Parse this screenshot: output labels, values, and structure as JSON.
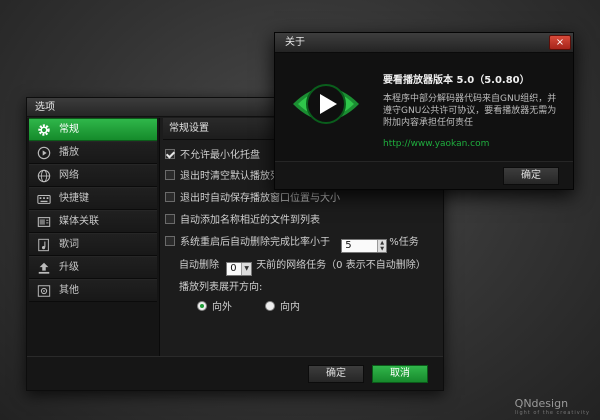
{
  "options": {
    "title": "选项",
    "sidebar": [
      {
        "label": "常规",
        "icon": "gear-icon"
      },
      {
        "label": "播放",
        "icon": "play-icon"
      },
      {
        "label": "网络",
        "icon": "globe-icon"
      },
      {
        "label": "快捷键",
        "icon": "keyboard-icon"
      },
      {
        "label": "媒体关联",
        "icon": "media-file-icon"
      },
      {
        "label": "歌词",
        "icon": "music-note-icon"
      },
      {
        "label": "升级",
        "icon": "upload-icon"
      },
      {
        "label": "其他",
        "icon": "misc-icon"
      }
    ],
    "section_title": "常规设置",
    "options": {
      "no_minimize_tray": "不允许最小化托盘",
      "clear_default_playlist": "退出时清空默认播放列表",
      "save_window_pos": "退出时自动保存播放窗口位置与大小",
      "auto_add_similar": "自动添加名称相近的文件到列表",
      "restart_delete": "系统重启后自动删除完成比率小于",
      "restart_delete_value": "5",
      "restart_delete_suffix": "%任务",
      "auto_delete_prefix": "自动删除",
      "auto_delete_value": "0",
      "auto_delete_suffix": "天前的网络任务（0 表示不自动删除）",
      "playlist_expand_label": "播放列表展开方向:",
      "radio_outward": "向外",
      "radio_inward": "向内"
    },
    "ok_label": "确定",
    "cancel_label": "取消"
  },
  "about": {
    "title": "关于",
    "close_symbol": "×",
    "app_name": "要看播放器版本 5.0（5.0.80）",
    "description": "本程序中部分解码器代码来自GNU组织，并遵守GNU公共许可协议，要看播放器无需为附加内容承担任何责任",
    "link": "http://www.yaokan.com",
    "ok_label": "确定"
  },
  "watermark": {
    "brand": "QNdesign",
    "tagline": "light of the creativity"
  },
  "colors": {
    "accent_green": "#1fae3e",
    "close_red": "#c0342a"
  }
}
